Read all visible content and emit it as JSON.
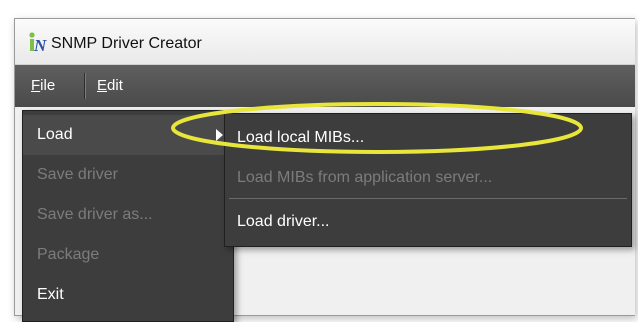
{
  "window": {
    "title": "SNMP Driver Creator",
    "icon": "app-logo-icon"
  },
  "menubar": {
    "file_label": "File",
    "file_mnemonic": "F",
    "file_rest": "ile",
    "edit_label": "Edit",
    "edit_mnemonic": "E",
    "edit_rest": "dit"
  },
  "file_menu": {
    "items": [
      {
        "label": "Load",
        "enabled": true,
        "has_submenu": true
      },
      {
        "label": "Save driver",
        "enabled": false
      },
      {
        "label": "Save driver as...",
        "enabled": false
      },
      {
        "label": "Package",
        "enabled": false
      },
      {
        "label": "Exit",
        "enabled": true
      }
    ]
  },
  "load_submenu": {
    "items": [
      {
        "label": "Load local MIBs...",
        "enabled": true
      },
      {
        "label": "Load MIBs from application server...",
        "enabled": false
      },
      {
        "label": "Load driver...",
        "enabled": true
      }
    ]
  },
  "colors": {
    "menu_bg": "#3d3d3d",
    "menubar_bg": "#555555",
    "highlight_ellipse": "#e8e63a",
    "disabled_text": "#7c7c7c"
  }
}
